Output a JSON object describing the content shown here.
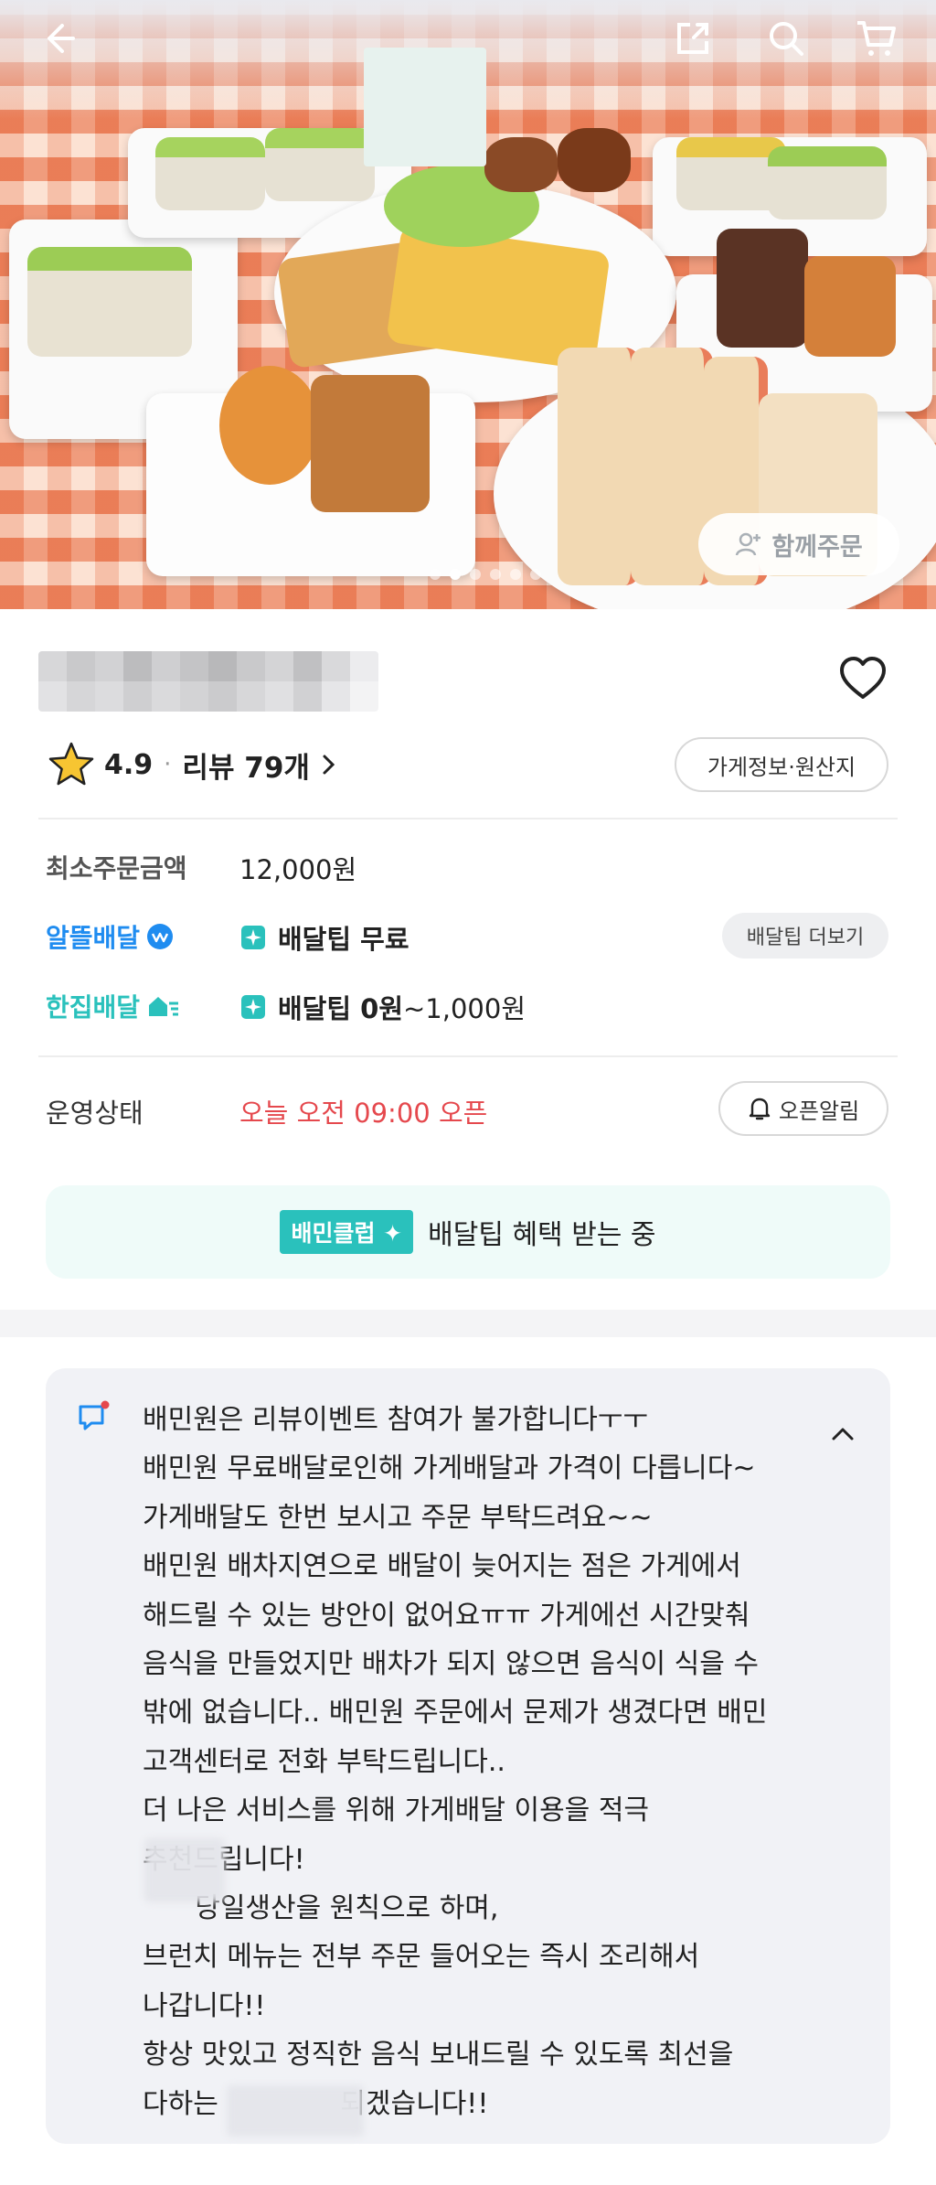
{
  "colors": {
    "accent_mint": "#2ac1bc",
    "savings_blue": "#1f8cf0",
    "open_status_red": "#e5484d"
  },
  "hero": {
    "group_order_label": "함께주문",
    "slide_count": 6,
    "active_slide": 1
  },
  "store": {
    "rating": "4.9",
    "review_label": "리뷰 79개",
    "info_button": "가게정보·원산지"
  },
  "order": {
    "min_order_label": "최소주문금액",
    "min_order_value": "12,000원",
    "saver_delivery_label": "알뜰배달",
    "saver_delivery_value": "배달팁 무료",
    "tip_more_button": "배달팁 더보기",
    "single_delivery_label": "한집배달",
    "single_delivery_value_bold": "배달팁 0원",
    "single_delivery_value_rest": "~1,000원"
  },
  "status": {
    "label": "운영상태",
    "value": "오늘 오전 09:00 오픈",
    "alarm_button": "오픈알림"
  },
  "club": {
    "tag": "배민클럽",
    "text": "배달팁 혜택 받는 중"
  },
  "notice": {
    "lines": [
      "배민원은 리뷰이벤트 참여가 불가합니다ㅜㅜ",
      "배민원 무료배달로인해 가게배달과 가격이 다릅니다~",
      "가게배달도 한번 보시고 주문 부탁드려요~~",
      "배민원 배차지연으로 배달이 늦어지는 점은 가게에서",
      "해드릴 수 있는 방안이 없어요ㅠㅠ 가게에선 시간맞춰",
      "음식을 만들었지만 배차가 되지 않으면 음식이 식을 수",
      "밖에 없습니다.. 배민원 주문에서 문제가 생겼다면 배민",
      "고객센터로 전화 부탁드립니다..",
      "더 나은 서비스를 위해 가게배달 이용을 적극",
      "추천드립니다!",
      "      당일생산을 원칙으로 하며,",
      "브런치 메뉴는 전부 주문 들어오는 즉시 조리해서",
      "나갑니다!!",
      "항상 맛있고 정직한 음식 보내드릴 수 있도록 최선을",
      "다하는              되겠습니다!!"
    ]
  }
}
